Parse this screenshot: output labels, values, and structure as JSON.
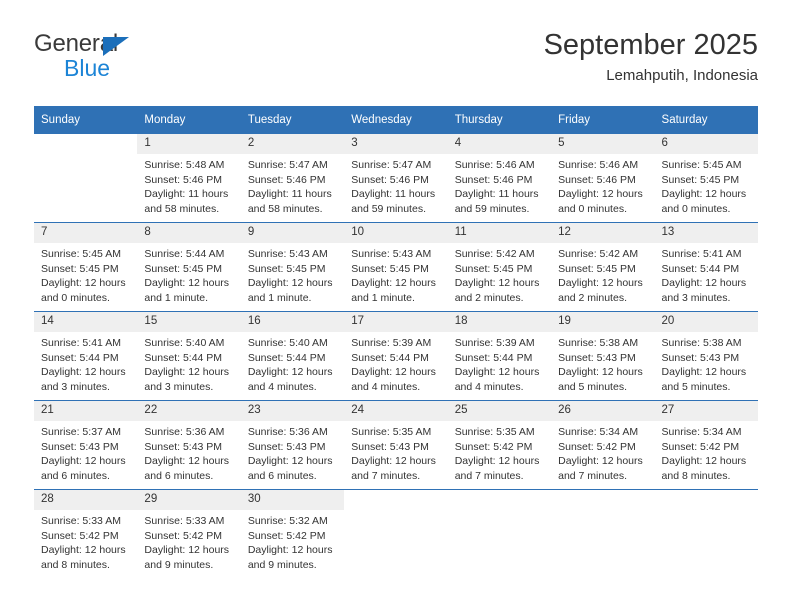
{
  "brand": {
    "line1": "General",
    "line2": "Blue",
    "triangle_color": "#1c6fba",
    "blue_color": "#1c84d6"
  },
  "header": {
    "title": "September 2025",
    "subtitle": "Lemahputih, Indonesia"
  },
  "theme": {
    "header_blue": "#2f71b5",
    "daynum_band": "#efefef",
    "text": "#333333"
  },
  "weekday_headers": [
    "Sunday",
    "Monday",
    "Tuesday",
    "Wednesday",
    "Thursday",
    "Friday",
    "Saturday"
  ],
  "weeks": [
    [
      {
        "day": "",
        "blank": true,
        "sunrise": "",
        "sunset": "",
        "daylight1": "",
        "daylight2": ""
      },
      {
        "day": "1",
        "sunrise": "Sunrise: 5:48 AM",
        "sunset": "Sunset: 5:46 PM",
        "daylight1": "Daylight: 11 hours",
        "daylight2": "and 58 minutes."
      },
      {
        "day": "2",
        "sunrise": "Sunrise: 5:47 AM",
        "sunset": "Sunset: 5:46 PM",
        "daylight1": "Daylight: 11 hours",
        "daylight2": "and 58 minutes."
      },
      {
        "day": "3",
        "sunrise": "Sunrise: 5:47 AM",
        "sunset": "Sunset: 5:46 PM",
        "daylight1": "Daylight: 11 hours",
        "daylight2": "and 59 minutes."
      },
      {
        "day": "4",
        "sunrise": "Sunrise: 5:46 AM",
        "sunset": "Sunset: 5:46 PM",
        "daylight1": "Daylight: 11 hours",
        "daylight2": "and 59 minutes."
      },
      {
        "day": "5",
        "sunrise": "Sunrise: 5:46 AM",
        "sunset": "Sunset: 5:46 PM",
        "daylight1": "Daylight: 12 hours",
        "daylight2": "and 0 minutes."
      },
      {
        "day": "6",
        "sunrise": "Sunrise: 5:45 AM",
        "sunset": "Sunset: 5:45 PM",
        "daylight1": "Daylight: 12 hours",
        "daylight2": "and 0 minutes."
      }
    ],
    [
      {
        "day": "7",
        "sunrise": "Sunrise: 5:45 AM",
        "sunset": "Sunset: 5:45 PM",
        "daylight1": "Daylight: 12 hours",
        "daylight2": "and 0 minutes."
      },
      {
        "day": "8",
        "sunrise": "Sunrise: 5:44 AM",
        "sunset": "Sunset: 5:45 PM",
        "daylight1": "Daylight: 12 hours",
        "daylight2": "and 1 minute."
      },
      {
        "day": "9",
        "sunrise": "Sunrise: 5:43 AM",
        "sunset": "Sunset: 5:45 PM",
        "daylight1": "Daylight: 12 hours",
        "daylight2": "and 1 minute."
      },
      {
        "day": "10",
        "sunrise": "Sunrise: 5:43 AM",
        "sunset": "Sunset: 5:45 PM",
        "daylight1": "Daylight: 12 hours",
        "daylight2": "and 1 minute."
      },
      {
        "day": "11",
        "sunrise": "Sunrise: 5:42 AM",
        "sunset": "Sunset: 5:45 PM",
        "daylight1": "Daylight: 12 hours",
        "daylight2": "and 2 minutes."
      },
      {
        "day": "12",
        "sunrise": "Sunrise: 5:42 AM",
        "sunset": "Sunset: 5:45 PM",
        "daylight1": "Daylight: 12 hours",
        "daylight2": "and 2 minutes."
      },
      {
        "day": "13",
        "sunrise": "Sunrise: 5:41 AM",
        "sunset": "Sunset: 5:44 PM",
        "daylight1": "Daylight: 12 hours",
        "daylight2": "and 3 minutes."
      }
    ],
    [
      {
        "day": "14",
        "sunrise": "Sunrise: 5:41 AM",
        "sunset": "Sunset: 5:44 PM",
        "daylight1": "Daylight: 12 hours",
        "daylight2": "and 3 minutes."
      },
      {
        "day": "15",
        "sunrise": "Sunrise: 5:40 AM",
        "sunset": "Sunset: 5:44 PM",
        "daylight1": "Daylight: 12 hours",
        "daylight2": "and 3 minutes."
      },
      {
        "day": "16",
        "sunrise": "Sunrise: 5:40 AM",
        "sunset": "Sunset: 5:44 PM",
        "daylight1": "Daylight: 12 hours",
        "daylight2": "and 4 minutes."
      },
      {
        "day": "17",
        "sunrise": "Sunrise: 5:39 AM",
        "sunset": "Sunset: 5:44 PM",
        "daylight1": "Daylight: 12 hours",
        "daylight2": "and 4 minutes."
      },
      {
        "day": "18",
        "sunrise": "Sunrise: 5:39 AM",
        "sunset": "Sunset: 5:44 PM",
        "daylight1": "Daylight: 12 hours",
        "daylight2": "and 4 minutes."
      },
      {
        "day": "19",
        "sunrise": "Sunrise: 5:38 AM",
        "sunset": "Sunset: 5:43 PM",
        "daylight1": "Daylight: 12 hours",
        "daylight2": "and 5 minutes."
      },
      {
        "day": "20",
        "sunrise": "Sunrise: 5:38 AM",
        "sunset": "Sunset: 5:43 PM",
        "daylight1": "Daylight: 12 hours",
        "daylight2": "and 5 minutes."
      }
    ],
    [
      {
        "day": "21",
        "sunrise": "Sunrise: 5:37 AM",
        "sunset": "Sunset: 5:43 PM",
        "daylight1": "Daylight: 12 hours",
        "daylight2": "and 6 minutes."
      },
      {
        "day": "22",
        "sunrise": "Sunrise: 5:36 AM",
        "sunset": "Sunset: 5:43 PM",
        "daylight1": "Daylight: 12 hours",
        "daylight2": "and 6 minutes."
      },
      {
        "day": "23",
        "sunrise": "Sunrise: 5:36 AM",
        "sunset": "Sunset: 5:43 PM",
        "daylight1": "Daylight: 12 hours",
        "daylight2": "and 6 minutes."
      },
      {
        "day": "24",
        "sunrise": "Sunrise: 5:35 AM",
        "sunset": "Sunset: 5:43 PM",
        "daylight1": "Daylight: 12 hours",
        "daylight2": "and 7 minutes."
      },
      {
        "day": "25",
        "sunrise": "Sunrise: 5:35 AM",
        "sunset": "Sunset: 5:42 PM",
        "daylight1": "Daylight: 12 hours",
        "daylight2": "and 7 minutes."
      },
      {
        "day": "26",
        "sunrise": "Sunrise: 5:34 AM",
        "sunset": "Sunset: 5:42 PM",
        "daylight1": "Daylight: 12 hours",
        "daylight2": "and 7 minutes."
      },
      {
        "day": "27",
        "sunrise": "Sunrise: 5:34 AM",
        "sunset": "Sunset: 5:42 PM",
        "daylight1": "Daylight: 12 hours",
        "daylight2": "and 8 minutes."
      }
    ],
    [
      {
        "day": "28",
        "sunrise": "Sunrise: 5:33 AM",
        "sunset": "Sunset: 5:42 PM",
        "daylight1": "Daylight: 12 hours",
        "daylight2": "and 8 minutes."
      },
      {
        "day": "29",
        "sunrise": "Sunrise: 5:33 AM",
        "sunset": "Sunset: 5:42 PM",
        "daylight1": "Daylight: 12 hours",
        "daylight2": "and 9 minutes."
      },
      {
        "day": "30",
        "sunrise": "Sunrise: 5:32 AM",
        "sunset": "Sunset: 5:42 PM",
        "daylight1": "Daylight: 12 hours",
        "daylight2": "and 9 minutes."
      },
      {
        "day": "",
        "blank": true,
        "sunrise": "",
        "sunset": "",
        "daylight1": "",
        "daylight2": ""
      },
      {
        "day": "",
        "blank": true,
        "sunrise": "",
        "sunset": "",
        "daylight1": "",
        "daylight2": ""
      },
      {
        "day": "",
        "blank": true,
        "sunrise": "",
        "sunset": "",
        "daylight1": "",
        "daylight2": ""
      },
      {
        "day": "",
        "blank": true,
        "sunrise": "",
        "sunset": "",
        "daylight1": "",
        "daylight2": ""
      }
    ]
  ]
}
